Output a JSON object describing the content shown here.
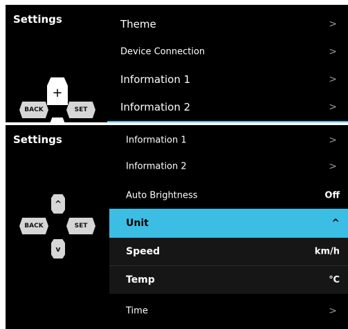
{
  "top": {
    "title": "Settings",
    "controller": {
      "back": "BACK",
      "set": "SET",
      "plus": "+"
    },
    "menu": [
      {
        "label": "Theme",
        "chevron": ">"
      },
      {
        "label": "Device Connection",
        "chevron": ">"
      },
      {
        "label": "Information 1",
        "chevron": ">"
      },
      {
        "label": "Information 2",
        "chevron": ">"
      }
    ]
  },
  "bottom": {
    "title": "Settings",
    "controller": {
      "back": "BACK",
      "set": "SET",
      "up": "^",
      "down": "v"
    },
    "menu": {
      "info1": {
        "label": "Information 1",
        "chevron": ">"
      },
      "info2": {
        "label": "Information 2",
        "chevron": ">"
      },
      "auto_brightness": {
        "label": "Auto Brightness",
        "value": "Off"
      },
      "unit": {
        "label": "Unit",
        "chevron": "^"
      },
      "speed": {
        "label": "Speed",
        "value": "km/h"
      },
      "temp": {
        "label": "Temp",
        "value": "℃"
      },
      "time": {
        "label": "Time",
        "chevron": ">"
      }
    }
  },
  "colors": {
    "accent": "#3fc0e4",
    "background": "#000000",
    "button": "#d6d6d6"
  }
}
